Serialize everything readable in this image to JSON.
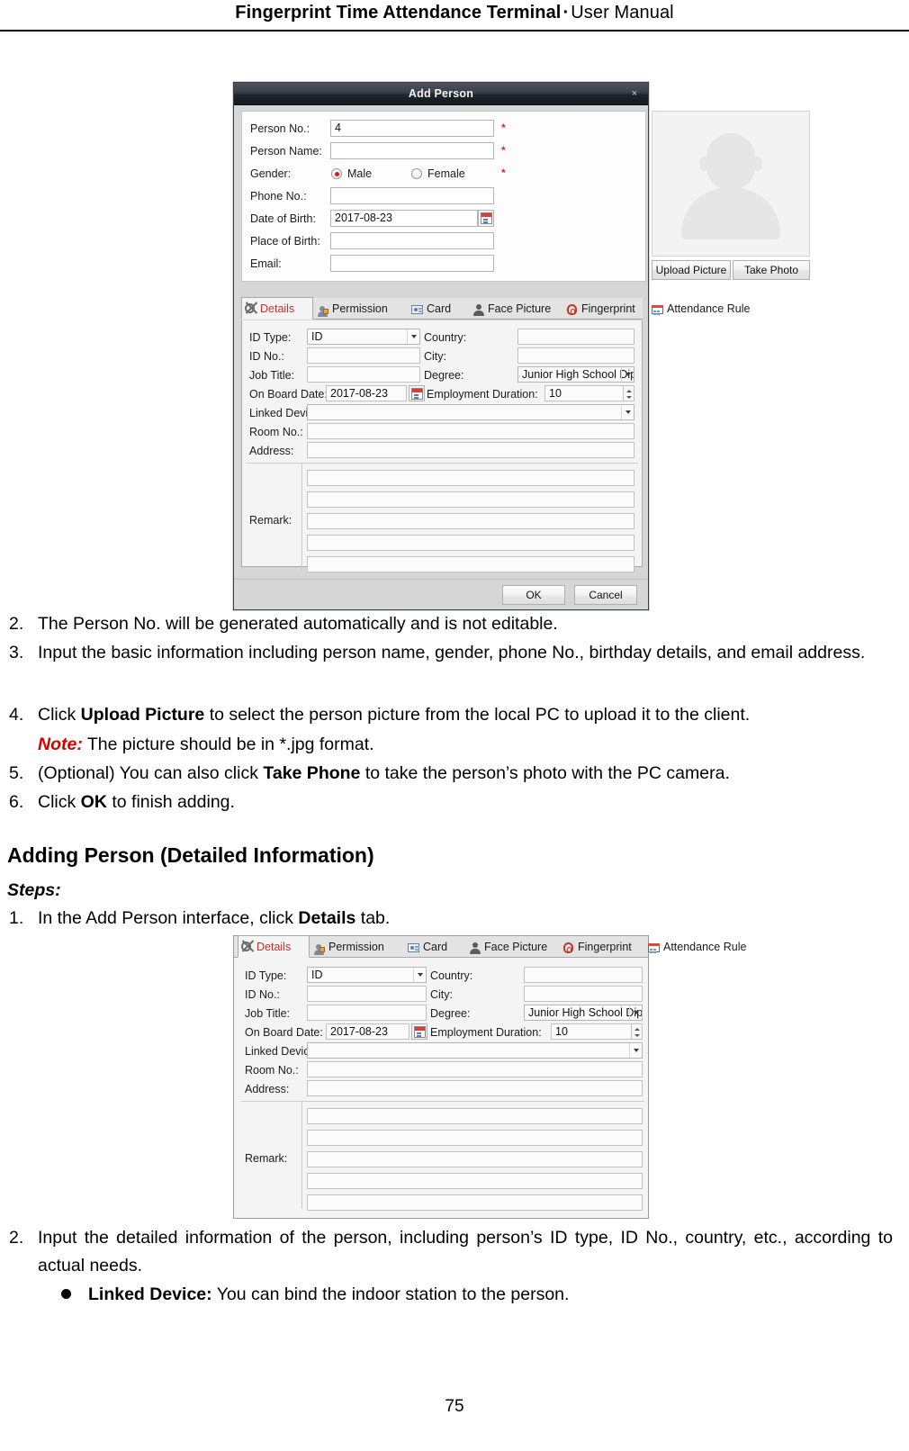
{
  "page_header": {
    "title_bold": "Fingerprint Time Attendance Terminal",
    "separator": "·",
    "title_rest": "User Manual"
  },
  "page_number": "75",
  "dialog": {
    "title": "Add Person",
    "close_icon": "×",
    "basic_fields": [
      {
        "label": "Person No.:",
        "value": "4",
        "required": true
      },
      {
        "label": "Person Name:",
        "value": "",
        "required": true
      },
      {
        "label": "Gender:",
        "value": "",
        "required": true
      },
      {
        "label": "Phone No.:",
        "value": "",
        "required": false
      },
      {
        "label": "Date of Birth:",
        "value": "2017-08-23",
        "required": false
      },
      {
        "label": "Place of Birth:",
        "value": "",
        "required": false
      },
      {
        "label": "Email:",
        "value": "",
        "required": false
      }
    ],
    "gender": {
      "male_label": "Male",
      "female_label": "Female",
      "selected": "Male"
    },
    "required_mark": "*",
    "photo": {
      "upload_label": "Upload Picture",
      "take_photo_label": "Take Photo"
    },
    "footer": {
      "ok_label": "OK",
      "cancel_label": "Cancel"
    }
  },
  "details_panel": {
    "tabs": [
      {
        "label": "Details",
        "icon": "gear-icon",
        "active": true
      },
      {
        "label": "Permission",
        "icon": "person-lock-icon",
        "active": false
      },
      {
        "label": "Card",
        "icon": "id-card-icon",
        "active": false
      },
      {
        "label": "Face Picture",
        "icon": "person-icon",
        "active": false
      },
      {
        "label": "Fingerprint",
        "icon": "fingerprint-icon",
        "active": false
      },
      {
        "label": "Attendance Rule",
        "icon": "calendar-grid-icon",
        "active": false
      }
    ],
    "fields": {
      "id_type_label": "ID Type:",
      "id_type_value": "ID",
      "country_label": "Country:",
      "country_value": "",
      "id_no_label": "ID No.:",
      "id_no_value": "",
      "city_label": "City:",
      "city_value": "",
      "job_title_label": "Job Title:",
      "job_title_value": "",
      "degree_label": "Degree:",
      "degree_value": "Junior High School Diploma",
      "on_board_date_label": "On Board Date:",
      "on_board_date_value": "2017-08-23",
      "employment_duration_label": "Employment Duration:",
      "employment_duration_value": "10",
      "linked_device_label": "Linked Device:",
      "linked_device_value": "",
      "room_no_label": "Room No.:",
      "room_no_value": "",
      "address_label": "Address:",
      "address_value": "",
      "remark_label": "Remark:",
      "remark_lines": [
        "",
        "",
        "",
        "",
        ""
      ]
    }
  },
  "body": {
    "step2_num": "2.",
    "step2_text": "The Person No. will be generated automatically and is not editable.",
    "step3_num": "3.",
    "step3_text": "Input the basic information including person name, gender, phone No., birthday details, and email address.",
    "step4_num": "4.",
    "step4_a": "Click ",
    "step4_b": "Upload Picture",
    "step4_c": " to select the person picture from the local PC to upload it to the client.",
    "step4_note_label": "Note:",
    "step4_note_text": " The picture should be in *.jpg format.",
    "step5_num": "5.",
    "step5_a": "(Optional) You can also click ",
    "step5_b": "Take Phone",
    "step5_c": " to take the person’s photo with the PC camera.",
    "step6_num": "6.",
    "step6_a": "Click ",
    "step6_b": "OK",
    "step6_c": " to finish adding.",
    "heading": "Adding Person (Detailed Information)",
    "steps_label": "Steps:",
    "s1_num": "1.",
    "s1_a": "In the Add Person interface, click ",
    "s1_b": "Details",
    "s1_c": " tab.",
    "s2_num": "2.",
    "s2_text": "Input the detailed information of the person, including person’s ID type, ID No., country, etc., according to actual needs.",
    "bullet_label": "Linked Device:",
    "bullet_text": " You can bind the indoor station to the person."
  },
  "colors": {
    "note_red": "#d40000",
    "tab_active_red": "#c9302c",
    "required_red": "#d82f2f",
    "titlebar_dark": "#20252c"
  }
}
